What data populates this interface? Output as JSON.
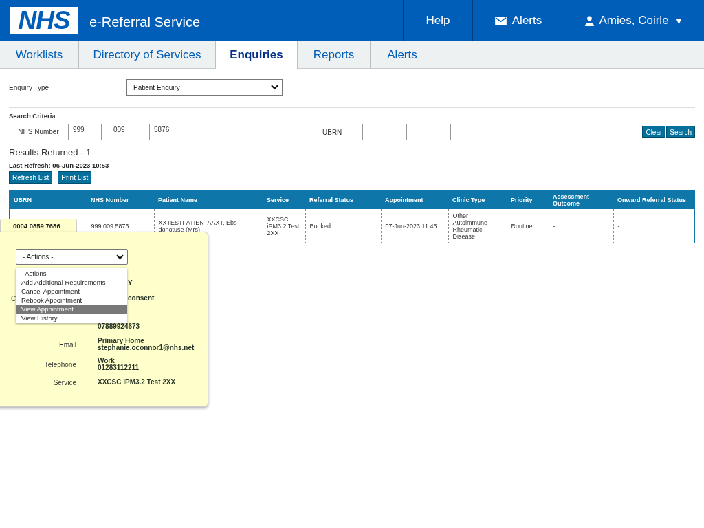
{
  "header": {
    "logo": "NHS",
    "title": "e-Referral Service",
    "nav": [
      {
        "label": "Help"
      },
      {
        "label": "Alerts"
      },
      {
        "label": "Amies, Coirle",
        "caret": "▼"
      }
    ]
  },
  "tabs": [
    {
      "label": "Worklists",
      "selected": false
    },
    {
      "label": "Directory of Services",
      "selected": false
    },
    {
      "label": "Enquiries",
      "selected": true
    },
    {
      "label": "Reports",
      "selected": false
    },
    {
      "label": "Alerts",
      "selected": false
    }
  ],
  "enquiry_type": {
    "label": "Enquiry Type",
    "value": "Patient Enquiry"
  },
  "search_criteria": {
    "title": "Search Criteria",
    "nhs_label": "NHS Number",
    "nhs_parts": [
      "999",
      "009",
      "5876"
    ],
    "ubrn_label": "UBRN",
    "buttons": [
      "Clear",
      "Search"
    ]
  },
  "results": {
    "count_text": "Results Returned - 1",
    "last_refresh": "Last Refresh: 06-Jun-2023 10:53",
    "buttons": [
      "Refresh List",
      "Print List"
    ]
  },
  "table": {
    "columns": [
      "UBRN",
      "NHS Number",
      "Patient Name",
      "Service",
      "Referral Status",
      "Appointment",
      "Clinic Type",
      "Priority",
      "Assessment Outcome",
      "Onward Referral Status"
    ],
    "rows": [
      [
        "",
        "999 009 5876",
        "XXTESTPATIENTAAXT, Ebs-donotuse (Mrs)",
        "XXCSC iPM3.2 Test 2XX",
        "Booked",
        "07-Jun-2023 11:45",
        "Other Autoimmune Rheumatic Disease",
        "Routine",
        "-",
        "-"
      ]
    ]
  },
  "popup": {
    "ubrn": "0004 0859 7686",
    "actions_value": "- Actions -",
    "actions": [
      {
        "label": "- Actions -",
        "selected": false
      },
      {
        "label": "Add Additional Requirements",
        "selected": false
      },
      {
        "label": "Cancel Appointment",
        "selected": false
      },
      {
        "label": "Rebook Appointment",
        "selected": false
      },
      {
        "label": "View Appointment",
        "selected": true
      },
      {
        "label": "View History",
        "selected": false
      }
    ],
    "details": [
      {
        "kind": "partial",
        "value": "Y"
      },
      {
        "kind": "partial",
        "label": "C",
        "value": "consent"
      },
      {
        "kind": "full",
        "value": "07889924673"
      },
      {
        "kind": "full",
        "label": "Email",
        "value": "Primary Home",
        "value2": "stephanie.oconnor1@nhs.net"
      },
      {
        "kind": "full",
        "label": "Telephone",
        "value": "Work",
        "value2": "01283112211"
      },
      {
        "kind": "full",
        "label": "Service",
        "value": "XXCSC iPM3.2 Test 2XX"
      }
    ]
  }
}
